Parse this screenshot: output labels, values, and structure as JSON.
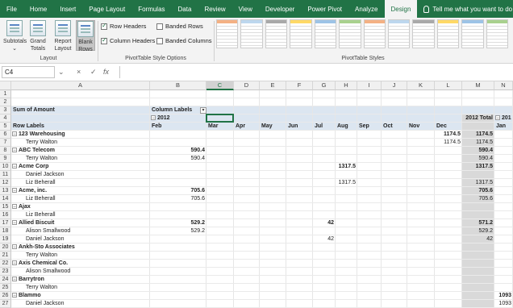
{
  "tabs": [
    "File",
    "Home",
    "Insert",
    "Page Layout",
    "Formulas",
    "Data",
    "Review",
    "View",
    "Developer",
    "Power Pivot",
    "Analyze",
    "Design"
  ],
  "active_tab": "Design",
  "tell_me": "Tell me what you want to do",
  "ribbon": {
    "layout": {
      "subtotals": "Subtotals",
      "grand_totals": [
        "Grand",
        "Totals"
      ],
      "report_layout": [
        "Report",
        "Layout"
      ],
      "blank_rows": [
        "Blank",
        "Rows"
      ],
      "label": "Layout"
    },
    "style_options": {
      "row_headers": "Row Headers",
      "column_headers": "Column Headers",
      "banded_rows": "Banded Rows",
      "banded_columns": "Banded Columns",
      "label": "PivotTable Style Options"
    },
    "styles_label": "PivotTable Styles",
    "style_colors": [
      "#f4b183",
      "#bdd7ee",
      "#a9a9a9",
      "#ffd966",
      "#9dc3e6",
      "#a9d18e",
      "#f4b183",
      "#bdd7ee",
      "#a9a9a9",
      "#ffd966",
      "#9dc3e6",
      "#a9d18e"
    ]
  },
  "formula_bar": {
    "name_box": "C4",
    "cancel_icon": "×",
    "enter_icon": "✓",
    "fx_label": "fx",
    "value": ""
  },
  "columns": [
    "A",
    "B",
    "C",
    "D",
    "E",
    "F",
    "G",
    "H",
    "I",
    "J",
    "K",
    "L",
    "M",
    "N"
  ],
  "rows": [
    {
      "n": "1"
    },
    {
      "n": "2"
    },
    {
      "n": "3",
      "a": "Sum of Amount",
      "b": "Column Labels"
    },
    {
      "n": "4",
      "b": "2012",
      "m": "2012 Total",
      "nn": "201"
    },
    {
      "n": "5",
      "a": "Row Labels",
      "b": "Feb",
      "c": "Mar",
      "d": "Apr",
      "e": "May",
      "f": "Jun",
      "g": "Jul",
      "h": "Aug",
      "i": "Sep",
      "j": "Oct",
      "k": "Nov",
      "l": "Dec",
      "nn": "Jan"
    },
    {
      "n": "6",
      "a": "123 Warehousing",
      "group": true,
      "l": "1174.5",
      "m": "1174.5"
    },
    {
      "n": "7",
      "a": "Terry Walton",
      "l": "1174.5",
      "m": "1174.5"
    },
    {
      "n": "8",
      "a": "ABC Telecom",
      "group": true,
      "b": "590.4",
      "m": "590.4"
    },
    {
      "n": "9",
      "a": "Terry Walton",
      "b": "590.4",
      "m": "590.4"
    },
    {
      "n": "10",
      "a": "Acme Corp",
      "group": true,
      "h": "1317.5",
      "m": "1317.5"
    },
    {
      "n": "11",
      "a": "Daniel Jackson"
    },
    {
      "n": "12",
      "a": "Liz Beherall",
      "h": "1317.5",
      "m": "1317.5"
    },
    {
      "n": "13",
      "a": "Acme, inc.",
      "group": true,
      "b": "705.6",
      "m": "705.6"
    },
    {
      "n": "14",
      "a": "Liz Beherall",
      "b": "705.6",
      "m": "705.6"
    },
    {
      "n": "15",
      "a": "Ajax",
      "group": true
    },
    {
      "n": "16",
      "a": "Liz Beherall"
    },
    {
      "n": "17",
      "a": "Allied Biscuit",
      "group": true,
      "b": "529.2",
      "g": "42",
      "m": "571.2"
    },
    {
      "n": "18",
      "a": "Alison Smallwood",
      "b": "529.2",
      "m": "529.2"
    },
    {
      "n": "19",
      "a": "Daniel Jackson",
      "g": "42",
      "m": "42"
    },
    {
      "n": "20",
      "a": "Ankh-Sto Associates",
      "group": true
    },
    {
      "n": "21",
      "a": "Terry Walton"
    },
    {
      "n": "22",
      "a": "Axis Chemical Co.",
      "group": true
    },
    {
      "n": "23",
      "a": "Alison Smallwood"
    },
    {
      "n": "24",
      "a": "Barrytron",
      "group": true
    },
    {
      "n": "25",
      "a": "Terry Walton"
    },
    {
      "n": "26",
      "a": "Blammo",
      "group": true,
      "nn": "1093"
    },
    {
      "n": "27",
      "a": "Daniel Jackson",
      "nn": "1093"
    }
  ],
  "colors": {
    "accent": "#217346",
    "pivot_header": "#dce6f1",
    "total_col": "#d9d9d9"
  }
}
